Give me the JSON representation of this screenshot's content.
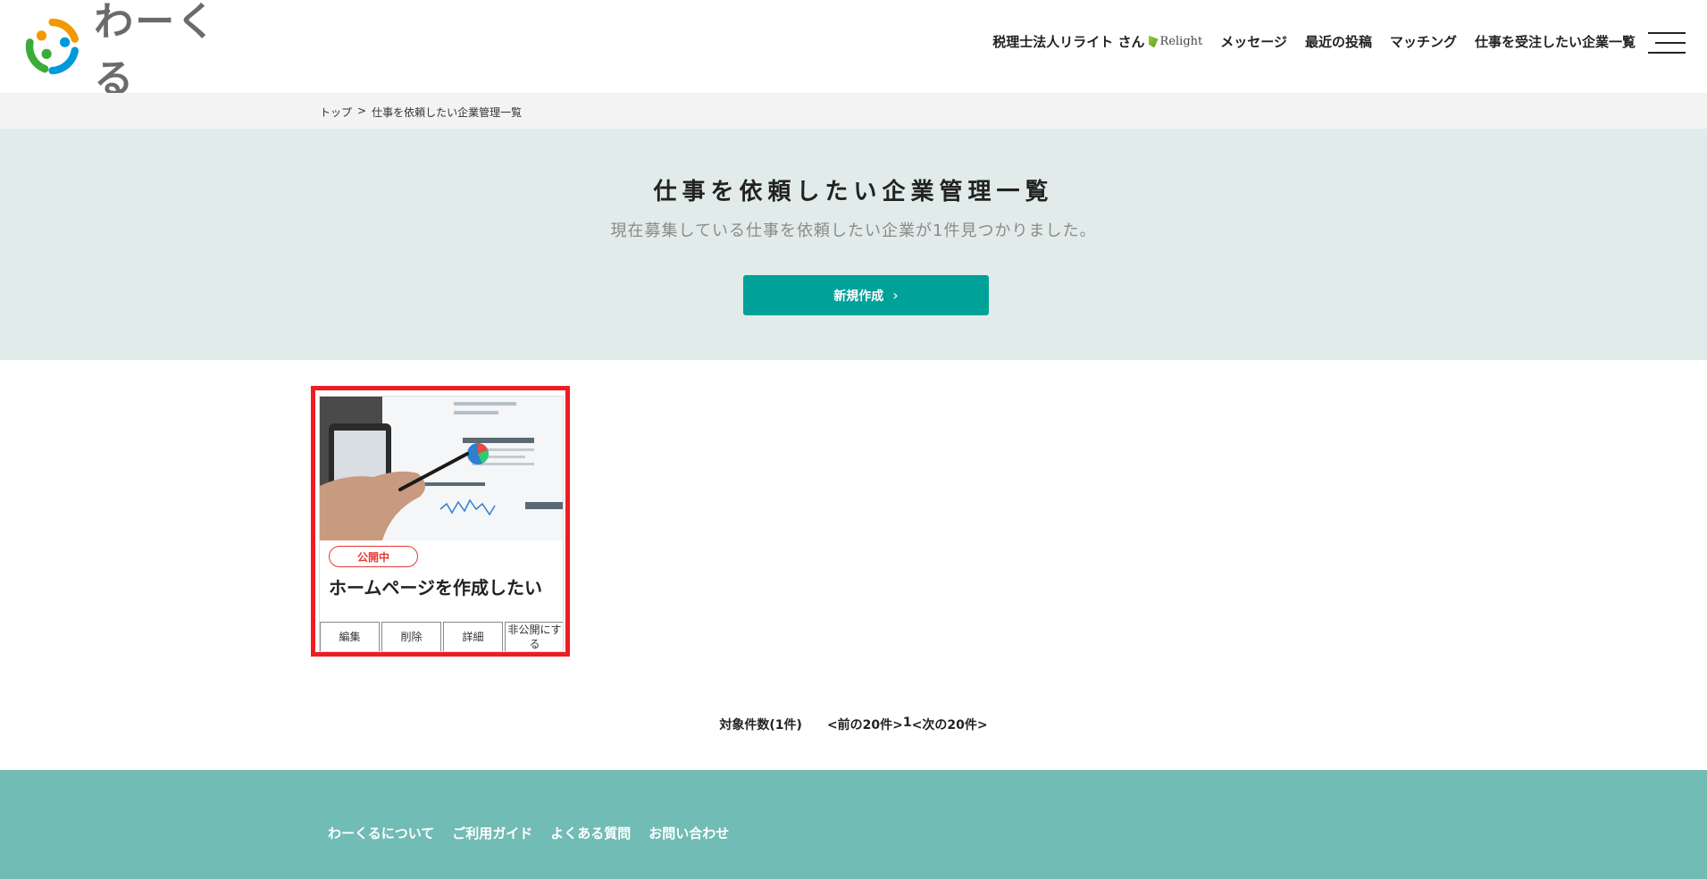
{
  "header": {
    "logo_text": "わーくる",
    "user_name": "税理士法人リライト さん",
    "company_logo_text": "Relight",
    "nav": [
      "メッセージ",
      "最近の投稿",
      "マッチング",
      "仕事を受注したい企業一覧"
    ]
  },
  "breadcrumb": {
    "top": "トップ",
    "separator": ">",
    "current": "仕事を依頼したい企業管理一覧"
  },
  "hero": {
    "title": "仕事を依頼したい企業管理一覧",
    "subtitle": "現在募集している仕事を依頼したい企業が1件見つかりました。",
    "new_button": "新規作成"
  },
  "card": {
    "status": "公開中",
    "title": "ホームページを作成したい",
    "actions": {
      "edit": "編集",
      "delete": "削除",
      "detail": "詳細",
      "unpublish": "非公開にする"
    }
  },
  "pagination": {
    "count": "対象件数(1件)",
    "prev": "<前の20件>",
    "page": "1",
    "next": "<次の20件>"
  },
  "footer": {
    "links": [
      "わーくるについて",
      "ご利用ガイド",
      "よくある質問",
      "お問い合わせ"
    ]
  },
  "colors": {
    "accent": "#00a199",
    "hero_bg": "#e1ecea",
    "footer_bg": "#71bcb4",
    "status_red": "#e53935",
    "highlight": "#ee1c24"
  }
}
